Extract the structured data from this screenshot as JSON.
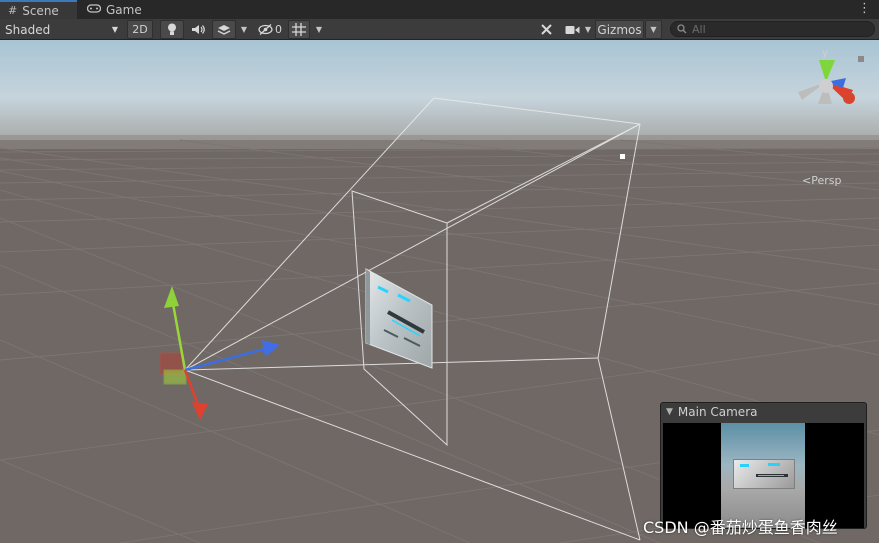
{
  "tabs": [
    {
      "label": "Scene",
      "icon": "grid-icon",
      "active": true
    },
    {
      "label": "Game",
      "icon": "gamepad-icon",
      "active": false
    }
  ],
  "toolbar": {
    "shading_mode": "Shaded",
    "mode_2d": "2D",
    "hidden_count": "0",
    "gizmos_label": "Gizmos",
    "search_placeholder": "All"
  },
  "scene": {
    "projection_label": "Persp",
    "orientation_axis_label": "y"
  },
  "camera_preview": {
    "title": "Main Camera"
  },
  "watermark": "CSDN @番茄炒蛋鱼香肉丝",
  "colors": {
    "accent_tab": "#3a79bb",
    "axis_x": "#e0412f",
    "axis_y": "#7fd63b",
    "axis_z": "#3b6fe0",
    "ground": "#6f6865",
    "sky": "#b9cfdc"
  }
}
